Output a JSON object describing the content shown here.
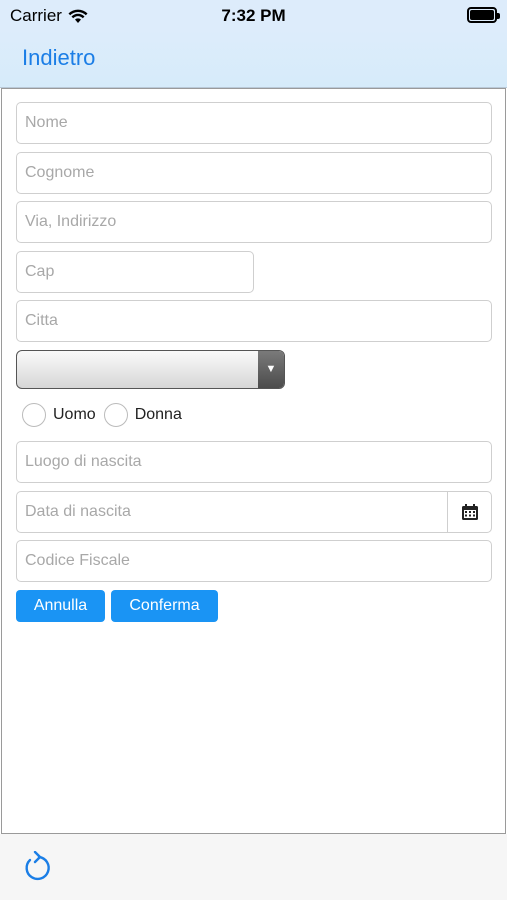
{
  "status_bar": {
    "carrier": "Carrier",
    "time": "7:32 PM"
  },
  "nav": {
    "back_label": "Indietro"
  },
  "form": {
    "nome_placeholder": "Nome",
    "cognome_placeholder": "Cognome",
    "indirizzo_placeholder": "Via, Indirizzo",
    "cap_placeholder": "Cap",
    "citta_placeholder": "Citta",
    "province_selected": "",
    "gender": {
      "male_label": "Uomo",
      "female_label": "Donna"
    },
    "luogo_placeholder": "Luogo di nascita",
    "data_placeholder": "Data di nascita",
    "cf_placeholder": "Codice Fiscale"
  },
  "actions": {
    "cancel_label": "Annulla",
    "confirm_label": "Conferma"
  },
  "icons": {
    "calendar": "calendar-icon",
    "refresh": "refresh-icon",
    "wifi": "wifi-icon",
    "battery": "battery-icon",
    "dropdown": "chevron-down-icon"
  },
  "colors": {
    "accent": "#1a94f4",
    "nav_text": "#1b7ee6",
    "nav_bg": "#ddecfb"
  }
}
